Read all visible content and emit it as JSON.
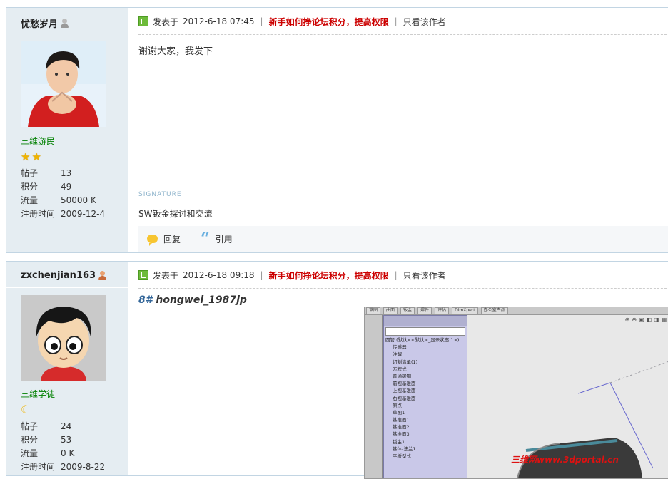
{
  "posts": [
    {
      "author": "忧愁岁月",
      "group": "三维游民",
      "stats": [
        {
          "label": "帖子",
          "value": "13"
        },
        {
          "label": "积分",
          "value": "49"
        },
        {
          "label": "流量",
          "value": "50000 K"
        },
        {
          "label": "注册时间",
          "value": "2009-12-4"
        }
      ],
      "posted_label": "发表于",
      "posted_time": "2012-6-18 07:45",
      "promo_link": "新手如何挣论坛积分，提高权限",
      "author_only": "只看该作者",
      "content": "谢谢大家，我发下",
      "signature_label": "SIGNATURE",
      "signature": "SW钣金探讨和交流",
      "reply_label": "回复",
      "quote_label": "引用"
    },
    {
      "author": "zxchenjian163",
      "group": "三维学徒",
      "stats": [
        {
          "label": "帖子",
          "value": "24"
        },
        {
          "label": "积分",
          "value": "53"
        },
        {
          "label": "流量",
          "value": "0 K"
        },
        {
          "label": "注册时间",
          "value": "2009-8-22"
        }
      ],
      "posted_label": "发表于",
      "posted_time": "2012-6-18 09:18",
      "promo_link": "新手如何挣论坛积分，提高权限",
      "author_only": "只看该作者",
      "floor_number": "8#",
      "floor_user": "hongwei_1987jp",
      "screenshot": {
        "tabs": [
          "草图",
          "曲面",
          "钣金",
          "焊件",
          "评估",
          "DimXpert",
          "办公室产品"
        ],
        "tree_items": [
          "圆管  (默认<<默认>_显示状态 1>)",
          "传感器",
          "注解",
          "切割清单(1)",
          "方程式",
          "普通碳钢",
          "前视基准面",
          "上视基准面",
          "右视基准面",
          "原点",
          "草图1",
          "基准面1",
          "基准面2",
          "基准面3",
          "钣金1",
          "基体-法兰1",
          "平板型式"
        ],
        "watermark": "三维网www.3dportal.cn"
      }
    }
  ]
}
